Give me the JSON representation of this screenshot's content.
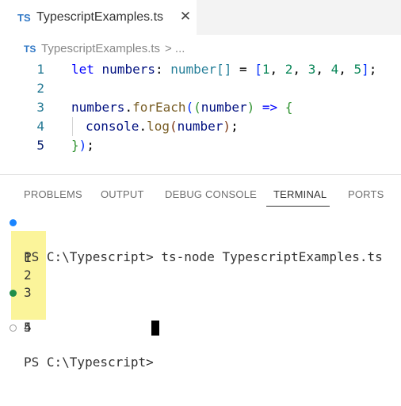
{
  "tab": {
    "badge": "TS",
    "title": "TypescriptExamples.ts",
    "close_glyph": "✕"
  },
  "breadcrumb": {
    "badge": "TS",
    "file": "TypescriptExamples.ts",
    "separator": "> ..."
  },
  "editor": {
    "line_numbers": [
      "1",
      "2",
      "3",
      "4",
      "5"
    ],
    "line1": {
      "kw": "let",
      "var": "numbers",
      "colon": ":",
      "type": "number",
      "brackets": "[]",
      "eq": " = ",
      "open": "[",
      "n1": "1",
      "n2": "2",
      "n3": "3",
      "n4": "4",
      "n5": "5",
      "close": "]",
      "semi": ";"
    },
    "line3": {
      "var": "numbers",
      "dot": ".",
      "fn": "forEach",
      "p1": "(",
      "p2": "(",
      "param": "number",
      "p2c": ")",
      "arrow": " => ",
      "brace": "{"
    },
    "line4": {
      "obj": "console",
      "dot": ".",
      "fn": "log",
      "p": "(",
      "arg": "number",
      "pc": ")",
      "semi": ";"
    },
    "line5": {
      "brace": "}",
      "pc": ")",
      "semi": ";"
    }
  },
  "panel": {
    "tabs": [
      "PROBLEMS",
      "OUTPUT",
      "DEBUG CONSOLE",
      "TERMINAL",
      "PORTS"
    ],
    "active_tab": "TERMINAL"
  },
  "terminal": {
    "command_line": "PS C:\\Typescript> ts-node TypescriptExamples.ts",
    "output": [
      "1",
      "2",
      "3",
      "4",
      "5"
    ],
    "prompt": "PS C:\\Typescript> "
  },
  "colors": {
    "ts_badge": "#3178c6",
    "highlight": "#fbf49a",
    "dot_blue": "#1a85ff",
    "dot_green": "#1f8e4a"
  },
  "icons": {
    "tab_badge": "typescript-file-icon",
    "close": "close-icon",
    "status_dots": [
      "command-status-blue-icon",
      "command-decoration-green-icon",
      "command-decoration-empty-icon"
    ]
  }
}
